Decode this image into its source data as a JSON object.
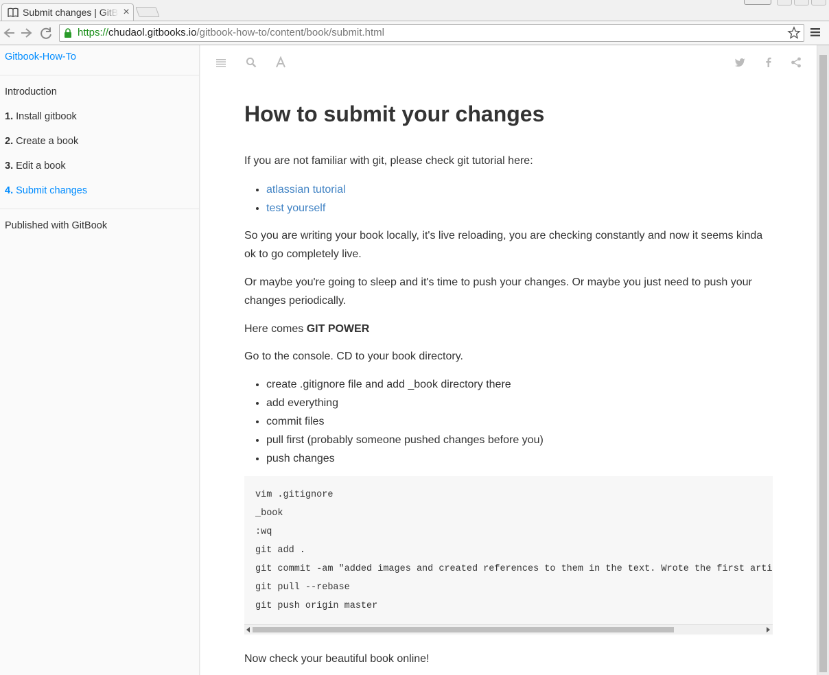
{
  "browser": {
    "tab_title": "Submit changes | GitBook",
    "tab_close": "×",
    "url_scheme": "https://",
    "url_host": "chudaol.gitbooks.io",
    "url_path": "/gitbook-how-to/content/book/submit.html",
    "icons": [
      "book-favicon-icon",
      "back-icon",
      "forward-icon",
      "reload-icon",
      "lock-icon",
      "star-icon",
      "menu-icon"
    ]
  },
  "sidebar": {
    "book_title": "Gitbook-How-To",
    "intro": "Introduction",
    "items": [
      {
        "num": "1.",
        "label": "Install gitbook"
      },
      {
        "num": "2.",
        "label": "Create a book"
      },
      {
        "num": "3.",
        "label": "Edit a book"
      },
      {
        "num": "4.",
        "label": "Submit changes",
        "active": true
      }
    ],
    "footer": "Published with GitBook"
  },
  "page_toolbar": {
    "left_icons": [
      "toc-icon",
      "search-icon",
      "font-settings-icon"
    ],
    "right_icons": [
      "twitter-icon",
      "facebook-icon",
      "share-icon"
    ]
  },
  "article": {
    "title": "How to submit your changes",
    "intro": "If you are not familiar with git, please check git tutorial here:",
    "links": [
      "atlassian tutorial",
      "test yourself"
    ],
    "para1": "So you are writing your book locally, it's live reloading, you are checking constantly and now it seems kinda ok to go completely live.",
    "para2": "Or maybe you're going to sleep and it's time to push your changes. Or maybe you just need to push your changes periodically.",
    "here_comes": "Here comes ",
    "git_power": "GIT POWER",
    "console": "Go to the console. CD to your book directory.",
    "steps": [
      "create .gitignore file and add _book directory there",
      "add everything",
      "commit files",
      "pull first (probably someone pushed changes before you)",
      "push changes"
    ],
    "code": [
      "vim .gitignore",
      "_book",
      ":wq",
      "git add .",
      "git commit -am \"added images and created references to them in the text. Wrote the first article",
      "git pull --rebase",
      "git push origin master"
    ],
    "outro": "Now check your beautiful book online!"
  },
  "colors": {
    "link": "#4183c4",
    "sidebar_active": "#008cff",
    "text": "#333333",
    "code_bg": "#f7f7f7"
  }
}
